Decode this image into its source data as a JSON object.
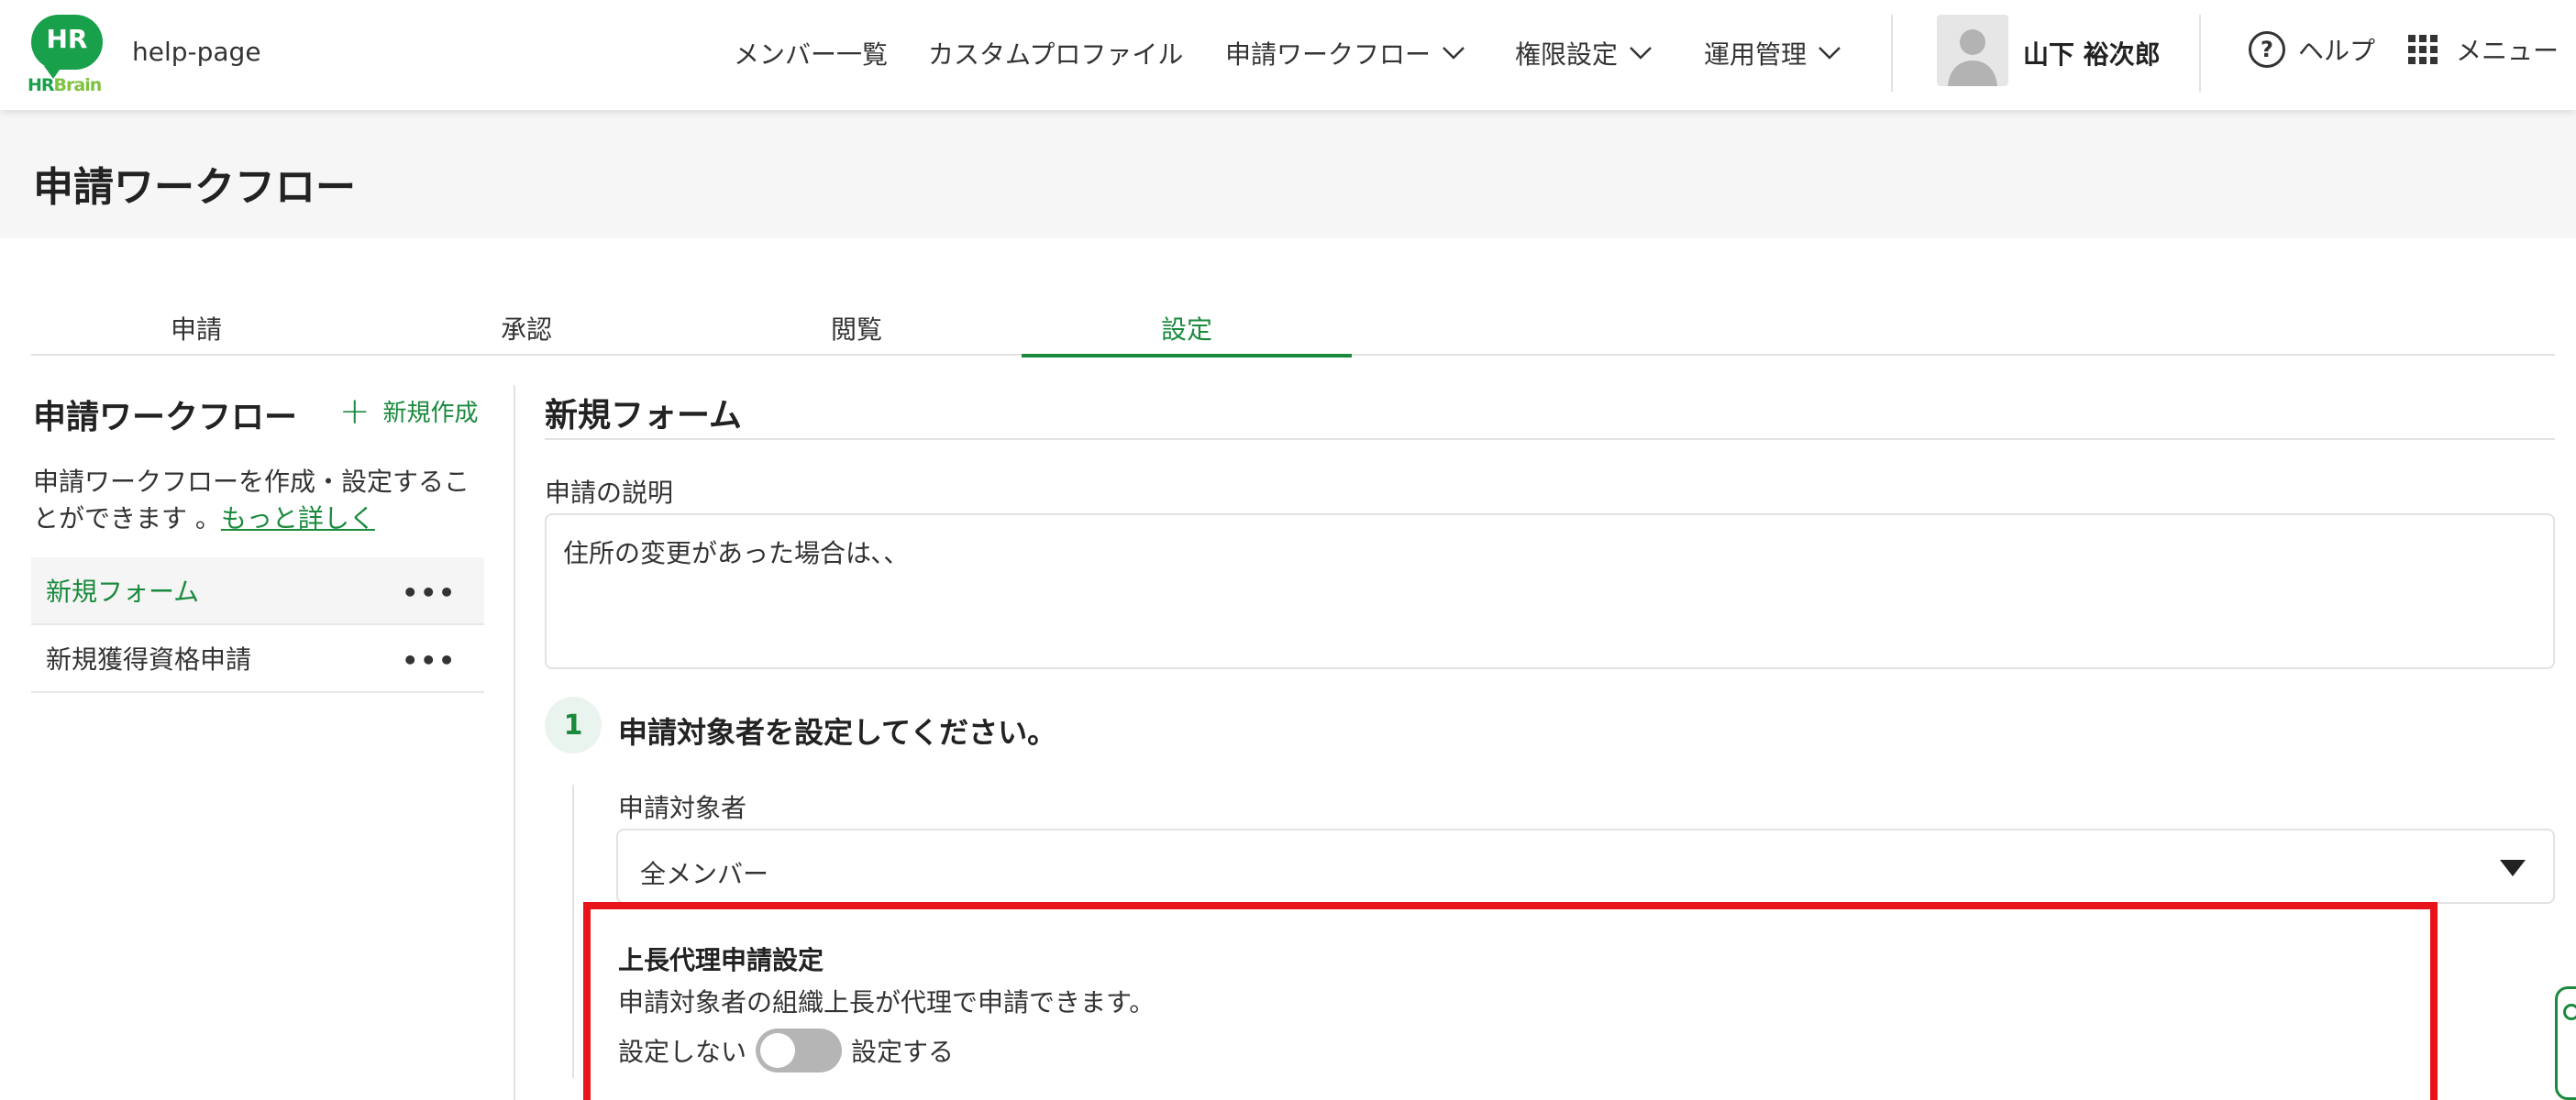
{
  "header": {
    "logo_text": "HR",
    "logo_brand": "HR",
    "logo_brand_suffix": "Brain",
    "site_name": "help-page",
    "nav": [
      {
        "label": "メンバー一覧"
      },
      {
        "label": "カスタムプロファイル"
      },
      {
        "label": "申請ワークフロー"
      },
      {
        "label": "権限設定"
      },
      {
        "label": "運用管理"
      }
    ],
    "user_name": "山下 裕次郎",
    "help_label": "ヘルプ",
    "help_symbol": "?",
    "menu_label": "メニュー"
  },
  "page": {
    "title": "申請ワークフロー"
  },
  "tabs": [
    {
      "label": "申請"
    },
    {
      "label": "承認"
    },
    {
      "label": "閲覧"
    },
    {
      "label": "設定"
    }
  ],
  "sidebar": {
    "title": "申請ワークフロー",
    "new_label": "新規作成",
    "new_symbol": "+",
    "description": "申請ワークフローを作成・設定することができます 。",
    "more_link": "もっと詳しく",
    "items": [
      {
        "label": "新規フォーム",
        "more": "•••"
      },
      {
        "label": "新規獲得資格申請",
        "more": "•••"
      }
    ]
  },
  "main": {
    "form_title": "新規フォーム",
    "description_label": "申請の説明",
    "description_value": "住所の変更があった場合は､､",
    "step1": {
      "number": "1",
      "title": "申請対象者を設定してください。",
      "target_label": "申請対象者",
      "target_value": "全メンバー"
    },
    "proxy": {
      "title": "上長代理申請設定",
      "description": "申請対象者の組織上長が代理で申請できます。",
      "off_label": "設定しない",
      "on_label": "設定する",
      "enabled": false
    }
  },
  "colors": {
    "accent": "#1a8a3d",
    "highlight": "#e8141a"
  }
}
